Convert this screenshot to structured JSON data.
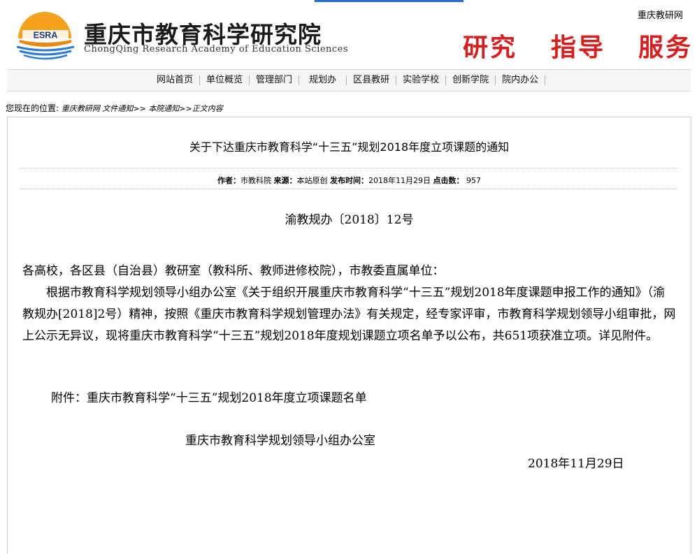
{
  "header": {
    "site_link": "重庆教研网",
    "logo_abbr": "ESRA",
    "title": "重庆市教育科学研究院",
    "subtitle": "ChongQing Research Academy of Education Sciences",
    "slogans": [
      "研究",
      "指导",
      "服务"
    ],
    "colors": {
      "accent_blue": "#2b6fd3",
      "slogan_red": "#d81e1e",
      "logo_orange": "#f4a21c"
    }
  },
  "nav": {
    "items": [
      "网站首页",
      "单位概览",
      "管理部门",
      "规划办",
      "区县教研",
      "实验学校",
      "创新学院",
      "院内办公"
    ]
  },
  "breadcrumb": {
    "label": "您现在的位置:",
    "items": [
      "重庆教研网",
      "文件通知>>",
      "本院通知>>",
      "正文内容"
    ],
    "sep": ">>"
  },
  "article": {
    "title": "关于下达重庆市教育科学“十三五”规划2018年度立项课题的通知",
    "meta": {
      "author_label": "作者：",
      "author": "市教科院",
      "source_label": "来源：",
      "source": "本站原创",
      "time_label": "发布时间：",
      "time": "2018年11月29日",
      "hits_label": "点击数：",
      "hits": "957"
    },
    "doc_number": "渝教规办〔2018〕12号",
    "salutation": "各高校，各区县（自治县）教研室（教科所、教师进修校院），市教委直属单位：",
    "paragraph": "根据市教育科学规划领导小组办公室《关于组织开展重庆市教育科学“十三五”规划2018年度课题申报工作的通知》（渝教规办[2018]2号）精神，按照《重庆市教育科学规划管理办法》有关规定，经专家评审，市教育科学规划领导小组审批，网上公示无异议，现将重庆市教育科学“十三五”规划2018年度规划课题立项名单予以公布，共651项获准立项。详见附件。",
    "attachment": "附件：重庆市教育科学“十三五”规划2018年度立项课题名单",
    "signature": "重庆市教育科学规划领导小组办公室",
    "date": "2018年11月29日"
  }
}
